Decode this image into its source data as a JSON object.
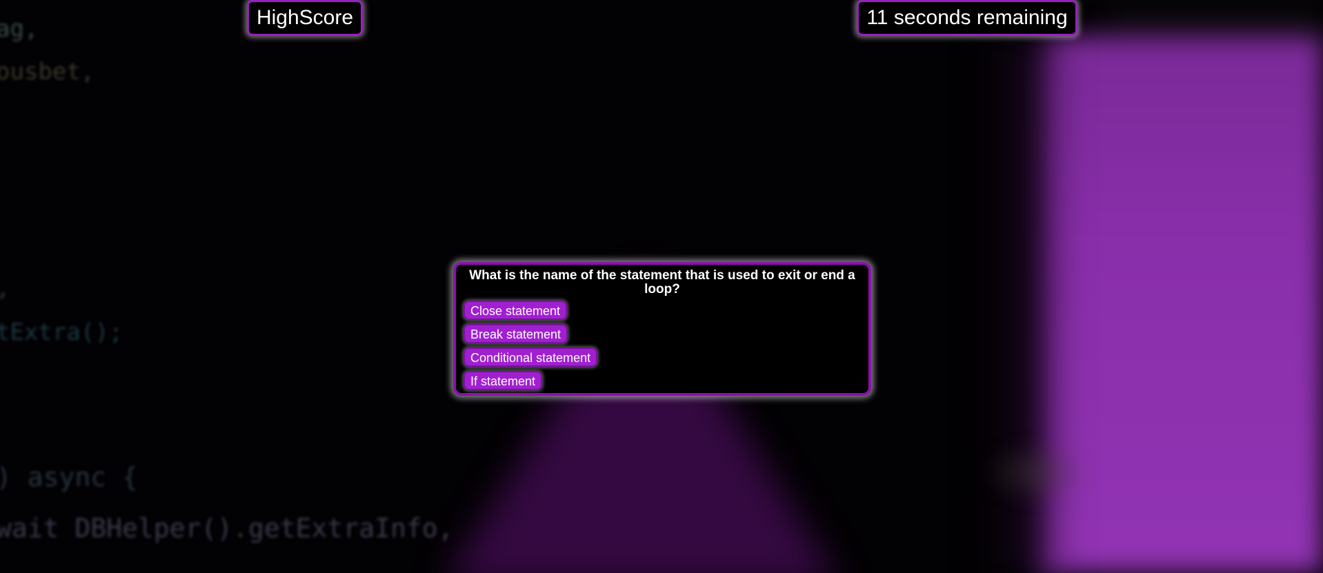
{
  "header": {
    "highscore_label": "HighScore",
    "timer_text": "11 seconds remaining"
  },
  "quiz": {
    "question": "What is the name of the statement that is used to exit or end a loop?",
    "answers": [
      "Close statement",
      "Break statement",
      "Conditional statement",
      "If statement"
    ]
  },
  "colors": {
    "accent": "#9a1fc0",
    "button_bg": "#a020d0",
    "background": "#000000"
  }
}
